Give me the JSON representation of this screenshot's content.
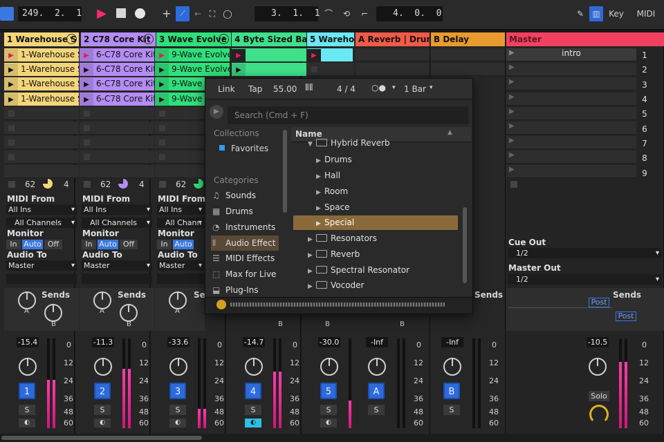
{
  "transport": {
    "position": "249.  2.  1",
    "loop_start": "3.  1.  1",
    "loop_length": "4.  0.  0"
  },
  "keys": {
    "key_label": "Key",
    "midi_label": "MIDI"
  },
  "tracks": [
    {
      "name": "1 Warehouse S",
      "color": "#f4d67a",
      "clips": [
        "1-Warehouse S",
        "1-Warehouse S",
        "1-Warehouse S",
        "1-Warehouse S"
      ],
      "stat1": "62",
      "stat2": "4",
      "vol": "-15.4",
      "num": "1"
    },
    {
      "name": "2 C78 Core Kit",
      "color": "#b48cf4",
      "clips": [
        "6-C78 Core Kit",
        "6-C78 Core Kit",
        "6-C78 Core Kit",
        "6-C78 Core Kit"
      ],
      "stat1": "62",
      "stat2": "4",
      "vol": "-11.3",
      "num": "2"
    },
    {
      "name": "3 Wave Evolve",
      "color": "#2fe07a",
      "clips": [
        "9-Wave Evolve",
        "9-Wave Evolve",
        "9-Wave",
        "9-Wave"
      ],
      "stat1": "62",
      "stat2": "",
      "vol": "-33.6",
      "num": "3"
    },
    {
      "name": "4 Byte Sized Bass",
      "color": "#3fe08a",
      "vol": "-14.7",
      "num": "4"
    },
    {
      "name": "5 Warehou",
      "color": "#6ae8f4",
      "vol": "-30.0",
      "num": "5"
    },
    {
      "name": "A Reverb | Drum",
      "color": "#f25a48",
      "vol": "-Inf",
      "num": "A"
    },
    {
      "name": "B Delay",
      "color": "#e89a2e",
      "vol": "-Inf",
      "num": "B"
    }
  ],
  "master": {
    "name": "Master",
    "scene1": "intro",
    "vol": "-10.5",
    "cue_out": "Cue Out",
    "cue_val": "1/2",
    "master_out": "Master Out",
    "master_val": "1/2",
    "solo": "Solo",
    "post1": "Post",
    "post2": "Post"
  },
  "io": {
    "midi_from": "MIDI From",
    "all_ins": "All Ins",
    "all_channels": "All Channels",
    "all_chann": "All Chann",
    "monitor": "Monitor",
    "in": "In",
    "auto": "Auto",
    "off": "Off",
    "audio_to": "Audio To",
    "master": "Master",
    "sends": "Sends",
    "se": "Se",
    "a": "A",
    "b": "B",
    "s": "S"
  },
  "scale": [
    "0",
    "12",
    "24",
    "36",
    "48",
    "60"
  ],
  "scenes": [
    "1",
    "2",
    "3",
    "4",
    "5",
    "6",
    "7",
    "8",
    "9"
  ],
  "browser": {
    "link": "Link",
    "tap": "Tap",
    "bpm": "55.00",
    "sig": "4 / 4",
    "quant": "1 Bar",
    "search_placeholder": "Search (Cmd + F)",
    "collections": "Collections",
    "favorites": "Favorites",
    "categories": "Categories",
    "cats": [
      "Sounds",
      "Drums",
      "Instruments",
      "Audio Effects",
      "MIDI Effects",
      "Max for Live",
      "Plug-Ins"
    ],
    "col_name": "Name",
    "items": [
      "Hybrid Reverb",
      "Drums",
      "Hall",
      "Room",
      "Space",
      "Special",
      "Resonators",
      "Reverb",
      "Spectral Resonator",
      "Vocoder"
    ]
  }
}
